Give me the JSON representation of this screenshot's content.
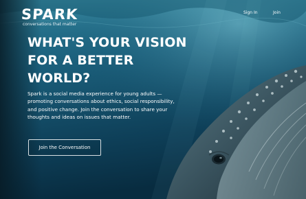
{
  "brand": {
    "logo_text": "SPARK",
    "tagline": "conversations that matter"
  },
  "nav": {
    "sign_in_label": "Sign In",
    "join_label": "Join"
  },
  "hero": {
    "title": "WHAT'S YOUR VISION FOR A BETTER WORLD?",
    "description": "Spark is a social media experience for young adults — promoting conversations about ethics, social responsibility, and positive change. Join the conversation to share your thoughts and ideas on issues that matter.",
    "cta_label": "Join the Conversation"
  },
  "colors": {
    "water_deep": "#0a2f44",
    "water_mid": "#1f6f8b",
    "water_light": "#5fb2c6",
    "text": "#ffffff"
  }
}
